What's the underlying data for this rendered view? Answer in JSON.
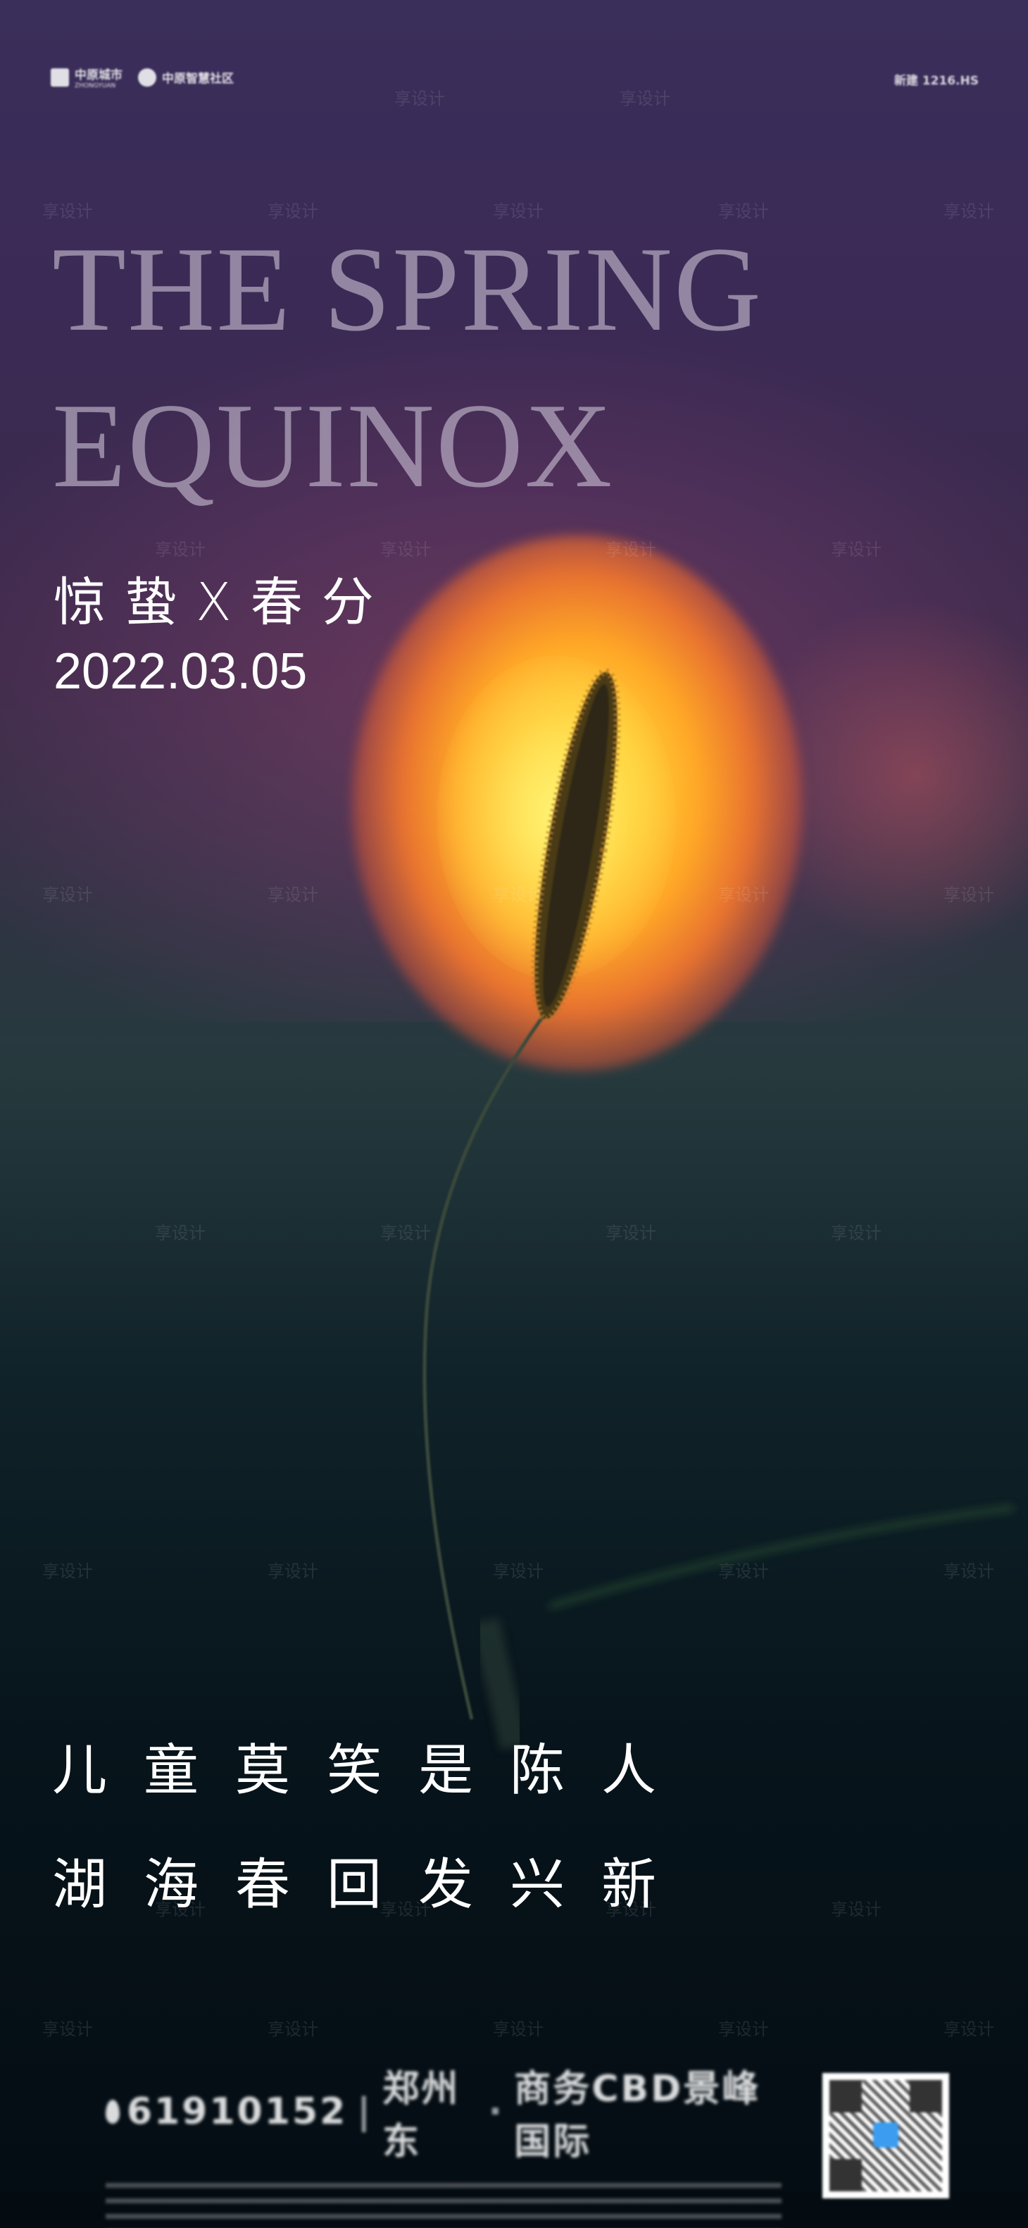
{
  "header": {
    "brand_primary": "中原城市",
    "brand_primary_sub": "ZHONGYUAN",
    "brand_secondary": "中原智慧社区",
    "presale": "新建 1216.HS"
  },
  "hero": {
    "title_line1": "THE SPRING",
    "title_line2": "EQUINOX",
    "subtitle": "惊蛰X春分",
    "date": "2022.03.05"
  },
  "poem": {
    "line1": "儿童莫笑是陈人",
    "line2": "湖海春回发兴新"
  },
  "footer": {
    "phone": "61910152",
    "location": "郑州东",
    "project": "商务CBD景峰国际"
  },
  "watermark": "享设计",
  "colors": {
    "sun": "#ffd23a",
    "sky": "#3b2a55",
    "ground": "#061017"
  }
}
